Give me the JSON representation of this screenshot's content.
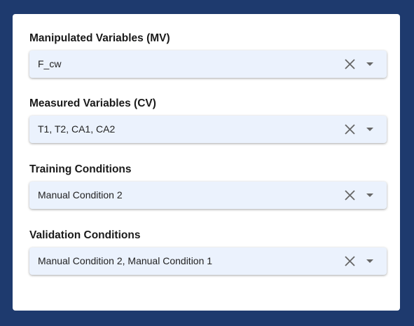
{
  "fields": [
    {
      "label": "Manipulated Variables (MV)",
      "value": "F_cw"
    },
    {
      "label": "Measured Variables (CV)",
      "value": "T1, T2, CA1, CA2"
    },
    {
      "label": "Training Conditions",
      "value": "Manual Condition 2"
    },
    {
      "label": "Validation Conditions",
      "value": "Manual Condition 2, Manual Condition 1"
    }
  ],
  "icons": {
    "clear": "close-icon",
    "dropdown": "caret-down-icon"
  }
}
